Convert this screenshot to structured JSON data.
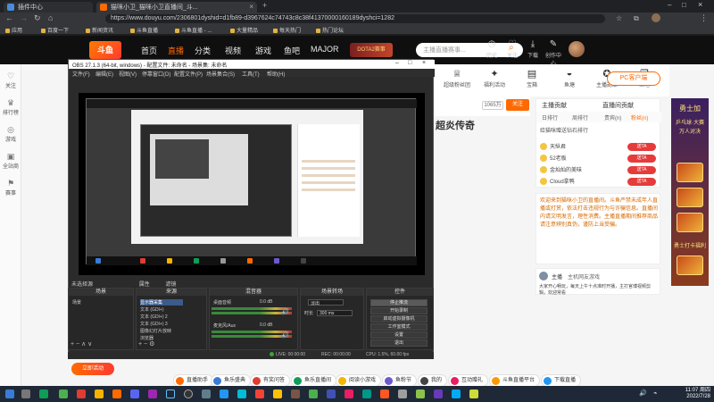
{
  "browser": {
    "tabs": [
      {
        "title": "插件中心",
        "active": false
      },
      {
        "title": "猫咪小卫_猫咪小卫直播间_斗...",
        "active": true
      }
    ],
    "new_tab": "+",
    "url": "https://www.douyu.com/2306801dyshid=d1fb89-d3967624c74743c8c38f41370000160189dyshci=1282",
    "bookmarks": [
      "应用",
      "百度一下",
      "新闻资讯",
      "斗鱼直播",
      "斗鱼直播 - ...",
      "大量精品",
      "每天热门",
      "热门论坛"
    ]
  },
  "header": {
    "logo": "斗鱼",
    "nav": [
      "首页",
      "直播",
      "分类",
      "视频",
      "游戏",
      "鱼吧",
      "MAJOR"
    ],
    "active_nav": "直播",
    "promo_badge": "DOTA2赛事",
    "search_placeholder": "主播直播赛事...",
    "icons": [
      "历史",
      "关注",
      "下载",
      "创作中心"
    ]
  },
  "sidebar": {
    "items": [
      "关注",
      "排行榜",
      "游戏",
      "全站商",
      "赛事"
    ]
  },
  "room": {
    "strip": [
      "超级粉丝团",
      "福利活动",
      "宝箱",
      "鱼塘",
      "主播勋章",
      "鱼吧"
    ],
    "pc_button": "PC客户端",
    "fans_count": "1065万",
    "follow_label": "关注",
    "title_fragment": "超炎传奇"
  },
  "rank": {
    "title": "主播贡献",
    "sub": "直播间贡献",
    "tabs": [
      "日排行",
      "周排行",
      "贵宾(n)",
      "粉丝(n)"
    ],
    "notice": "给猫咪赠送钻石排行",
    "rows": [
      {
        "name": "天纵君",
        "gift": "送TA"
      },
      {
        "name": "52老板",
        "gift": "送TA"
      },
      {
        "name": "金灿灿的美味",
        "gift": "送TA"
      },
      {
        "name": "Cloud拿鸭",
        "gift": "送TA"
      }
    ]
  },
  "promo": {
    "lines": [
      "勇士加",
      "乒乓球·大赛",
      "万人对决",
      "勇士打卡福利"
    ]
  },
  "chat": {
    "notice": "欢迎来到猫咪小卫的直播间。斗鱼严禁未成年人直播或打赏，依法打击违规行为与诈骗信息。直播间内请文明发言，理性消费。主播直播期间推荐商品请注意辨别真伪，谨防上当受骗。",
    "user": "主播",
    "user_tag": "主机网友游戏",
    "message": "大家开心畅玩，每天上午十点准时开播，主打官博视频剪辑，欢迎常看"
  },
  "obs": {
    "title": "OBS 27.1.3 (64-bit, windows) - 配置文件: 未命名 - 场景集: 未命名",
    "menu": [
      "文件(F)",
      "编辑(E)",
      "视图(V)",
      "停靠窗口(D)",
      "配置文件(P)",
      "场景集合(S)",
      "工具(T)",
      "帮助(H)"
    ],
    "source_tab": "未选择源",
    "props_label": "属性",
    "filter_label": "滤镜",
    "docks": {
      "scenes": {
        "title": "场景",
        "items": [
          "场景"
        ]
      },
      "sources": {
        "title": "来源",
        "items": [
          "显示器采集",
          "文本 (GDI+)",
          "文本 (GDI+) 2",
          "文本 (GDI+) 3",
          "图像幻灯片放映",
          "浏览器"
        ]
      },
      "mixer": {
        "title": "混音器",
        "channels": [
          {
            "name": "桌面音频",
            "db": "0.0 dB"
          },
          {
            "name": "麦克风/Aux",
            "db": "0.0 dB"
          }
        ]
      },
      "transitions": {
        "title": "场景转场",
        "fade": "淡出",
        "duration_label": "时长",
        "duration": "300 ms"
      },
      "controls": {
        "title": "控件",
        "buttons": [
          "停止推流",
          "开始录制",
          "启动虚拟摄像机",
          "工作室模式",
          "设置",
          "退出"
        ]
      }
    },
    "status": [
      "LIVE: 00:00:00",
      "REC: 00:00:00",
      "CPU: 1.5%, 60.00 fps"
    ]
  },
  "activity_button": "立即活动",
  "bottom_chips": [
    "直播助手",
    "鱼乐盛典",
    "有奖问答",
    "鱼乐直播间",
    "阅读小游戏",
    "鱼粉节",
    "我的",
    "互动赠礼",
    "斗鱼直播平台",
    "下载直播"
  ],
  "taskbar": {
    "time": "11:07 周四",
    "date": "2022/7/28"
  },
  "colors": {
    "douyu_orange": "#ff6a00",
    "obs_bg": "#2b2b2b",
    "taskbar": "#1f2836"
  }
}
